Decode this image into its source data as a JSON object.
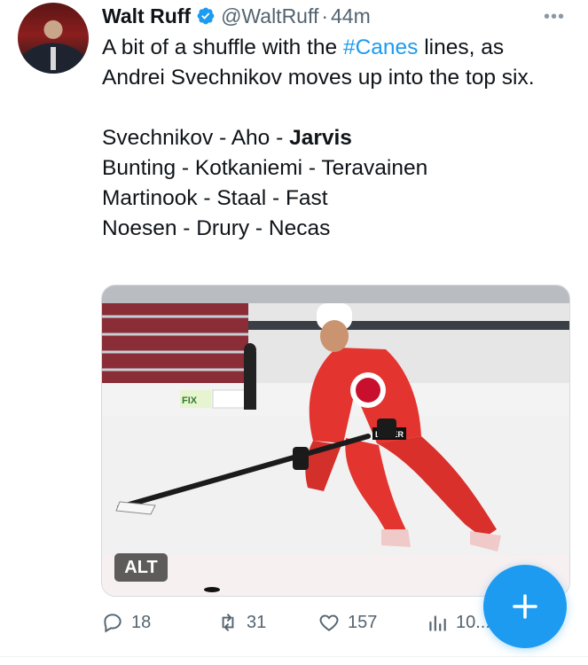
{
  "tweet": {
    "author_name": "Walt Ruff",
    "handle": "@WaltRuff",
    "separator": "·",
    "time": "44m",
    "text_prefix": "A bit of a shuffle with the ",
    "hashtag": "#Canes",
    "text_suffix": " lines, as Andrei Svechnikov moves up into the top six.",
    "lines": [
      {
        "pre": "Svechnikov - Aho - ",
        "bold": "Jarvis"
      },
      {
        "pre": "Bunting - Kotkaniemi - Teravainen",
        "bold": ""
      },
      {
        "pre": "Martinook - Staal - Fast",
        "bold": ""
      },
      {
        "pre": "Noesen - Drury - Necas",
        "bold": ""
      }
    ],
    "more_icon": "more-horizontal-icon",
    "verified_icon": "verified-badge-icon",
    "verified_color": "#1d9bf0"
  },
  "media": {
    "alt_label": "ALT",
    "jersey_color": "#e3342f",
    "rink_color": "#f4f4f4",
    "ad_texts": [
      "FIX",
      "BAUER"
    ]
  },
  "actions": {
    "replies": "18",
    "retweets": "31",
    "likes": "157",
    "views": "10..."
  },
  "fab": {
    "icon": "plus-icon",
    "color": "#1d9bf0"
  }
}
